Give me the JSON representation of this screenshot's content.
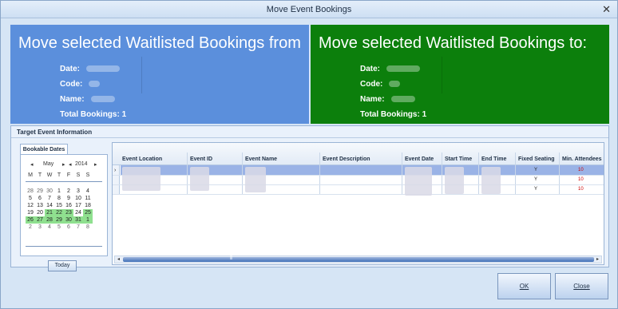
{
  "window": {
    "title": "Move Event Bookings",
    "close_glyph": "✕"
  },
  "from_panel": {
    "heading": "Move selected Waitlisted Bookings from",
    "date_label": "Date:",
    "code_label": "Code:",
    "name_label": "Name:",
    "total_label": "Total Bookings: 1",
    "color": "#5b8fdc"
  },
  "to_panel": {
    "heading": "Move selected Waitlisted Bookings to:",
    "date_label": "Date:",
    "code_label": "Code:",
    "name_label": "Name:",
    "total_label": "Total Bookings: 1",
    "color": "#0c7f0c"
  },
  "target": {
    "title": "Target Event Information",
    "tab_label": "Bookable Dates",
    "calendar": {
      "prev_month": "◂",
      "month": "May",
      "next_month": "▸",
      "prev_year": "◂",
      "year": "2014",
      "next_year": "▸",
      "weekdays": [
        "M",
        "T",
        "W",
        "T",
        "F",
        "S",
        "S"
      ],
      "weeks": [
        [
          "28",
          "29",
          "30",
          "1",
          "2",
          "3",
          "4"
        ],
        [
          "5",
          "6",
          "7",
          "8",
          "9",
          "10",
          "11"
        ],
        [
          "12",
          "13",
          "14",
          "15",
          "16",
          "17",
          "18"
        ],
        [
          "19",
          "20",
          "21",
          "22",
          "23",
          "24",
          "25"
        ],
        [
          "26",
          "27",
          "28",
          "29",
          "30",
          "31",
          "1"
        ],
        [
          "2",
          "3",
          "4",
          "5",
          "6",
          "7",
          "8"
        ]
      ],
      "highlight_color": "#8fe08f",
      "today_label": "Today"
    }
  },
  "grid": {
    "columns": [
      "Event Location",
      "Event ID",
      "Event Name",
      "Event Description",
      "Event Date",
      "Start Time",
      "End Time",
      "Fixed Seating",
      "Min. Attendees"
    ],
    "rows": [
      {
        "fixed_seating": "Y",
        "min_attendees": "10"
      },
      {
        "fixed_seating": "Y",
        "min_attendees": "10"
      },
      {
        "fixed_seating": "Y",
        "min_attendees": "10"
      }
    ],
    "row_indicator": "›",
    "scroll_left": "◂",
    "scroll_right": "▸",
    "scroll_grip": "⦀"
  },
  "buttons": {
    "ok": "OK",
    "close": "Close"
  }
}
